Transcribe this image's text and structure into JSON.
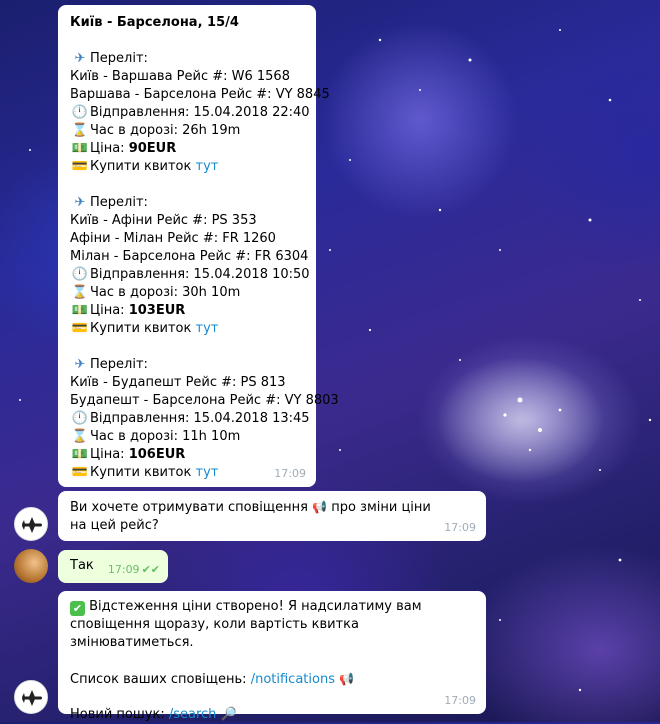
{
  "header": {
    "title": "Київ - Барселона, 15/4"
  },
  "flights": [
    {
      "label": "Переліт:",
      "legs": [
        "Київ - Варшава Рейс #: W6 1568",
        "Варшава - Барселона Рейс #: VY 8845"
      ],
      "departure": "Відправлення: 15.04.2018 22:40",
      "duration": "Час в дорозі: 26h 19m",
      "price_label": "Ціна: ",
      "price": "90EUR",
      "buy_text": "Купити квиток ",
      "buy_link": "тут"
    },
    {
      "label": "Переліт:",
      "legs": [
        "Київ - Афіни Рейс #: PS 353",
        "Афіни - Мілан Рейс #: FR 1260",
        "Мілан - Барселона Рейс #: FR 6304"
      ],
      "departure": "Відправлення: 15.04.2018 10:50",
      "duration": "Час в дорозі: 30h 10m",
      "price_label": "Ціна: ",
      "price": "103EUR",
      "buy_text": "Купити квиток ",
      "buy_link": "тут"
    },
    {
      "label": "Переліт:",
      "legs": [
        "Київ - Будапешт Рейс #: PS 813",
        "Будапешт - Барселона Рейс #: VY 8803"
      ],
      "departure": "Відправлення: 15.04.2018 13:45",
      "duration": "Час в дорозі: 11h 10m",
      "price_label": "Ціна: ",
      "price": "106EUR",
      "buy_text": "Купити квиток ",
      "buy_link": "тут"
    }
  ],
  "messages": {
    "m1_time": "17:09",
    "m2_text_a": "Ви хочете отримувати сповіщення ",
    "m2_text_b": " про зміни ціни на цей рейс?",
    "m2_time": "17:09",
    "m3_text": "Так",
    "m3_time": "17:09",
    "m4_text": "Відстеження ціни створено! Я надсилатиму вам сповіщення щоразу, коли вартість квитка змінюватиметься.",
    "m4_list_label": "Список ваших сповіщень: ",
    "m4_list_link": "/notifications",
    "m4_search_label": "Новий пошук: ",
    "m4_search_link": "/search",
    "m4_time": "17:09"
  },
  "icons": {
    "flight": "airplane-icon",
    "clock": "clock-icon",
    "hourglass": "hourglass-icon",
    "price": "money-icon",
    "ticket": "credit-card-icon",
    "speaker": "loudspeaker-icon",
    "check": "check-mark-icon",
    "search": "magnifier-icon"
  },
  "colors": {
    "link": "#168acd",
    "outgoing_bubble": "#eeffde",
    "read_check": "#5fbf5f"
  }
}
